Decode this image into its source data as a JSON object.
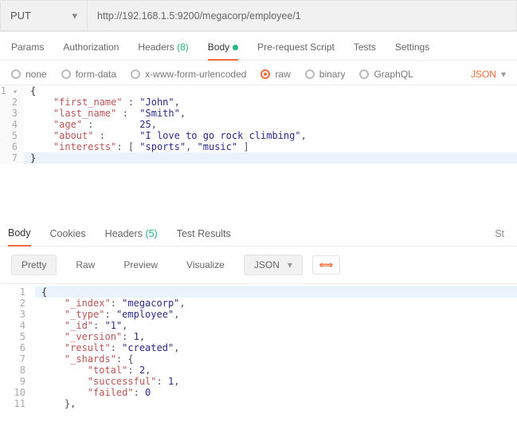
{
  "method": "PUT",
  "url": "http://192.168.1.5:9200/megacorp/employee/1",
  "tabs": {
    "params": "Params",
    "authorization": "Authorization",
    "headers": "Headers",
    "headers_count": "(8)",
    "body": "Body",
    "prereq": "Pre-request Script",
    "tests": "Tests",
    "settings": "Settings"
  },
  "body_opts": {
    "none": "none",
    "formdata": "form-data",
    "xwww": "x-www-form-urlencoded",
    "raw": "raw",
    "binary": "binary",
    "graphql": "GraphQL",
    "format": "JSON"
  },
  "req_code": {
    "l1": "{",
    "l2a": "    \"first_name\"",
    "l2b": " : ",
    "l2c": "\"John\"",
    "l2d": ",",
    "l3a": "    \"last_name\"",
    "l3b": " :  ",
    "l3c": "\"Smith\"",
    "l3d": ",",
    "l4a": "    \"age\"",
    "l4b": " :        ",
    "l4c": "25",
    "l4d": ",",
    "l5a": "    \"about\"",
    "l5b": " :      ",
    "l5c": "\"I love to go rock climbing\"",
    "l5d": ",",
    "l6a": "    \"interests\"",
    "l6b": ": [ ",
    "l6c": "\"sports\"",
    "l6d": ", ",
    "l6e": "\"music\"",
    "l6f": " ]",
    "l7": "}"
  },
  "resp_tabs": {
    "body": "Body",
    "cookies": "Cookies",
    "headers": "Headers",
    "headers_count": "(5)",
    "tests": "Test Results",
    "status": "St"
  },
  "resp_tools": {
    "pretty": "Pretty",
    "raw": "Raw",
    "preview": "Preview",
    "visualize": "Visualize",
    "json": "JSON"
  },
  "resp_code": {
    "l1": "{",
    "l2a": "    \"_index\"",
    "l2b": ": ",
    "l2c": "\"megacorp\"",
    "l2d": ",",
    "l3a": "    \"_type\"",
    "l3b": ": ",
    "l3c": "\"employee\"",
    "l3d": ",",
    "l4a": "    \"_id\"",
    "l4b": ": ",
    "l4c": "\"1\"",
    "l4d": ",",
    "l5a": "    \"_version\"",
    "l5b": ": ",
    "l5c": "1",
    "l5d": ",",
    "l6a": "    \"result\"",
    "l6b": ": ",
    "l6c": "\"created\"",
    "l6d": ",",
    "l7a": "    \"_shards\"",
    "l7b": ": {",
    "l8a": "        \"total\"",
    "l8b": ": ",
    "l8c": "2",
    "l8d": ",",
    "l9a": "        \"successful\"",
    "l9b": ": ",
    "l9c": "1",
    "l9d": ",",
    "l10a": "        \"failed\"",
    "l10b": ": ",
    "l10c": "0",
    "l11": "    },"
  }
}
